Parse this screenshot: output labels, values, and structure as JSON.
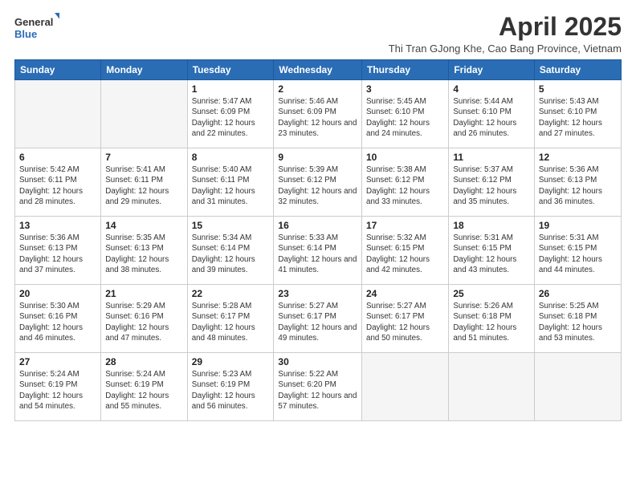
{
  "logo": {
    "general": "General",
    "blue": "Blue"
  },
  "title": "April 2025",
  "subtitle": "Thi Tran GJong Khe, Cao Bang Province, Vietnam",
  "weekdays": [
    "Sunday",
    "Monday",
    "Tuesday",
    "Wednesday",
    "Thursday",
    "Friday",
    "Saturday"
  ],
  "weeks": [
    [
      {
        "day": "",
        "info": ""
      },
      {
        "day": "",
        "info": ""
      },
      {
        "day": "1",
        "info": "Sunrise: 5:47 AM\nSunset: 6:09 PM\nDaylight: 12 hours and 22 minutes."
      },
      {
        "day": "2",
        "info": "Sunrise: 5:46 AM\nSunset: 6:09 PM\nDaylight: 12 hours and 23 minutes."
      },
      {
        "day": "3",
        "info": "Sunrise: 5:45 AM\nSunset: 6:10 PM\nDaylight: 12 hours and 24 minutes."
      },
      {
        "day": "4",
        "info": "Sunrise: 5:44 AM\nSunset: 6:10 PM\nDaylight: 12 hours and 26 minutes."
      },
      {
        "day": "5",
        "info": "Sunrise: 5:43 AM\nSunset: 6:10 PM\nDaylight: 12 hours and 27 minutes."
      }
    ],
    [
      {
        "day": "6",
        "info": "Sunrise: 5:42 AM\nSunset: 6:11 PM\nDaylight: 12 hours and 28 minutes."
      },
      {
        "day": "7",
        "info": "Sunrise: 5:41 AM\nSunset: 6:11 PM\nDaylight: 12 hours and 29 minutes."
      },
      {
        "day": "8",
        "info": "Sunrise: 5:40 AM\nSunset: 6:11 PM\nDaylight: 12 hours and 31 minutes."
      },
      {
        "day": "9",
        "info": "Sunrise: 5:39 AM\nSunset: 6:12 PM\nDaylight: 12 hours and 32 minutes."
      },
      {
        "day": "10",
        "info": "Sunrise: 5:38 AM\nSunset: 6:12 PM\nDaylight: 12 hours and 33 minutes."
      },
      {
        "day": "11",
        "info": "Sunrise: 5:37 AM\nSunset: 6:12 PM\nDaylight: 12 hours and 35 minutes."
      },
      {
        "day": "12",
        "info": "Sunrise: 5:36 AM\nSunset: 6:13 PM\nDaylight: 12 hours and 36 minutes."
      }
    ],
    [
      {
        "day": "13",
        "info": "Sunrise: 5:36 AM\nSunset: 6:13 PM\nDaylight: 12 hours and 37 minutes."
      },
      {
        "day": "14",
        "info": "Sunrise: 5:35 AM\nSunset: 6:13 PM\nDaylight: 12 hours and 38 minutes."
      },
      {
        "day": "15",
        "info": "Sunrise: 5:34 AM\nSunset: 6:14 PM\nDaylight: 12 hours and 39 minutes."
      },
      {
        "day": "16",
        "info": "Sunrise: 5:33 AM\nSunset: 6:14 PM\nDaylight: 12 hours and 41 minutes."
      },
      {
        "day": "17",
        "info": "Sunrise: 5:32 AM\nSunset: 6:15 PM\nDaylight: 12 hours and 42 minutes."
      },
      {
        "day": "18",
        "info": "Sunrise: 5:31 AM\nSunset: 6:15 PM\nDaylight: 12 hours and 43 minutes."
      },
      {
        "day": "19",
        "info": "Sunrise: 5:31 AM\nSunset: 6:15 PM\nDaylight: 12 hours and 44 minutes."
      }
    ],
    [
      {
        "day": "20",
        "info": "Sunrise: 5:30 AM\nSunset: 6:16 PM\nDaylight: 12 hours and 46 minutes."
      },
      {
        "day": "21",
        "info": "Sunrise: 5:29 AM\nSunset: 6:16 PM\nDaylight: 12 hours and 47 minutes."
      },
      {
        "day": "22",
        "info": "Sunrise: 5:28 AM\nSunset: 6:17 PM\nDaylight: 12 hours and 48 minutes."
      },
      {
        "day": "23",
        "info": "Sunrise: 5:27 AM\nSunset: 6:17 PM\nDaylight: 12 hours and 49 minutes."
      },
      {
        "day": "24",
        "info": "Sunrise: 5:27 AM\nSunset: 6:17 PM\nDaylight: 12 hours and 50 minutes."
      },
      {
        "day": "25",
        "info": "Sunrise: 5:26 AM\nSunset: 6:18 PM\nDaylight: 12 hours and 51 minutes."
      },
      {
        "day": "26",
        "info": "Sunrise: 5:25 AM\nSunset: 6:18 PM\nDaylight: 12 hours and 53 minutes."
      }
    ],
    [
      {
        "day": "27",
        "info": "Sunrise: 5:24 AM\nSunset: 6:19 PM\nDaylight: 12 hours and 54 minutes."
      },
      {
        "day": "28",
        "info": "Sunrise: 5:24 AM\nSunset: 6:19 PM\nDaylight: 12 hours and 55 minutes."
      },
      {
        "day": "29",
        "info": "Sunrise: 5:23 AM\nSunset: 6:19 PM\nDaylight: 12 hours and 56 minutes."
      },
      {
        "day": "30",
        "info": "Sunrise: 5:22 AM\nSunset: 6:20 PM\nDaylight: 12 hours and 57 minutes."
      },
      {
        "day": "",
        "info": ""
      },
      {
        "day": "",
        "info": ""
      },
      {
        "day": "",
        "info": ""
      }
    ]
  ]
}
